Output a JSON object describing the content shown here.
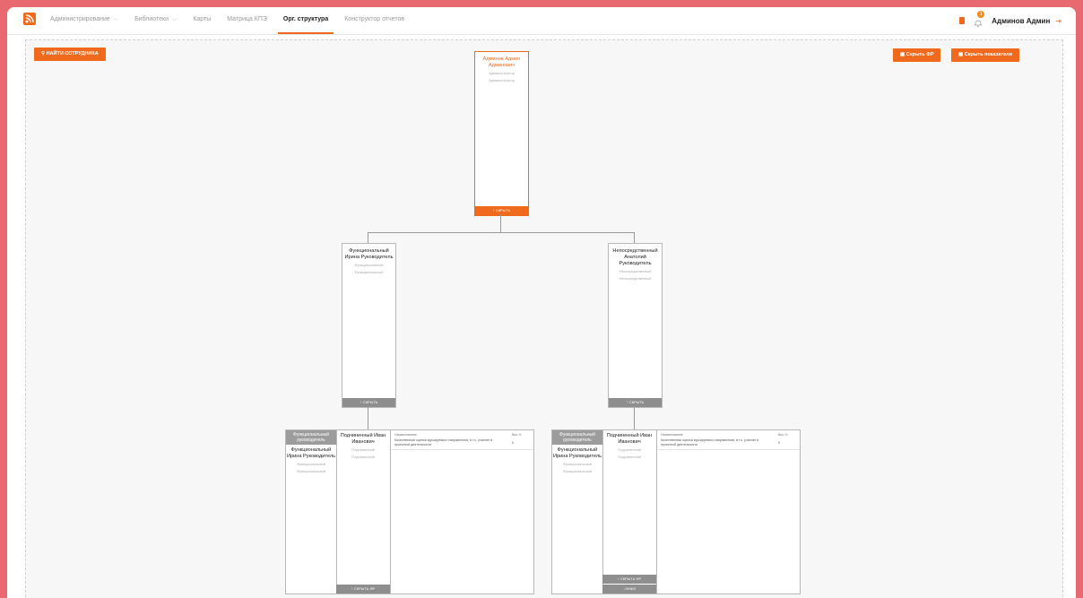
{
  "nav": {
    "items": [
      {
        "label": "Администрирование",
        "dropdown": true
      },
      {
        "label": "Библиотеки",
        "dropdown": true
      },
      {
        "label": "Карты",
        "dropdown": false
      },
      {
        "label": "Матрица КПЭ",
        "dropdown": false
      },
      {
        "label": "Орг. структура",
        "dropdown": false,
        "active": true
      },
      {
        "label": "Конструктор отчетов",
        "dropdown": false
      }
    ]
  },
  "header": {
    "user_name": "Админов Админ",
    "notifications_count": "1"
  },
  "toolbar": {
    "find_label": "НАЙТИ СОТРУДНИКА",
    "hide_fr_label": "Скрыть ФР",
    "hide_indicators_label": "Скрыть показатели"
  },
  "root": {
    "name": "Админов Админ Админович",
    "lines": [
      "Администратор",
      "Администратор"
    ],
    "footer": "СКРЫТЬ"
  },
  "mid": [
    {
      "name": "Функциональный Ирина Руководитель",
      "lines": [
        "Функциональный",
        "Функциональный"
      ],
      "footer": "СКРЫТЬ"
    },
    {
      "name": "Непосредственный Анатолий Руководитель",
      "lines": [
        "Непосредственный",
        "Непосредственный"
      ],
      "footer": "СКРЫТЬ"
    }
  ],
  "panels": [
    {
      "role_header": "Функциональный руководитель",
      "manager_name": "Функциональный Ирина Руководитель",
      "manager_lines": [
        "Функциональный",
        "Функциональный"
      ],
      "emp_name": "Подчиненный Иван Иванович",
      "emp_lines": [
        "Подчиненный",
        "Подчиненный"
      ],
      "col_name": "Наименование",
      "col_weight": "Вес,%",
      "row_name": "Качественная оценка курсируемого направления, в т.ч. участие в проектной деятельности",
      "row_weight": "0",
      "footer1": "СКРЫТЬ ФР",
      "footer2": ""
    },
    {
      "role_header": "Функциональный руководитель",
      "manager_name": "Функциональный Ирина Руководитель",
      "manager_lines": [
        "Функциональный",
        "Функциональный"
      ],
      "emp_name": "Подчиненный Иван Иванович",
      "emp_lines": [
        "Подчиненный",
        "Подчиненный"
      ],
      "col_name": "Наименование",
      "col_weight": "Вес,%",
      "row_name": "Качественная оценка курсируемого направления, в т.ч. участие в проектной деятельности",
      "row_weight": "0",
      "footer1": "СКРЫТЬ ФР",
      "footer2": "ВНИЗ"
    }
  ],
  "colors": {
    "accent": "#f06a1d",
    "background": "#e8696f",
    "grey_footer": "#8e8e8e"
  },
  "icons": [
    "logo-icon",
    "chevron-down-icon",
    "document-icon",
    "bell-icon",
    "logout-icon",
    "search-icon",
    "table-icon",
    "arrow-up-icon",
    "arrow-down-icon"
  ]
}
